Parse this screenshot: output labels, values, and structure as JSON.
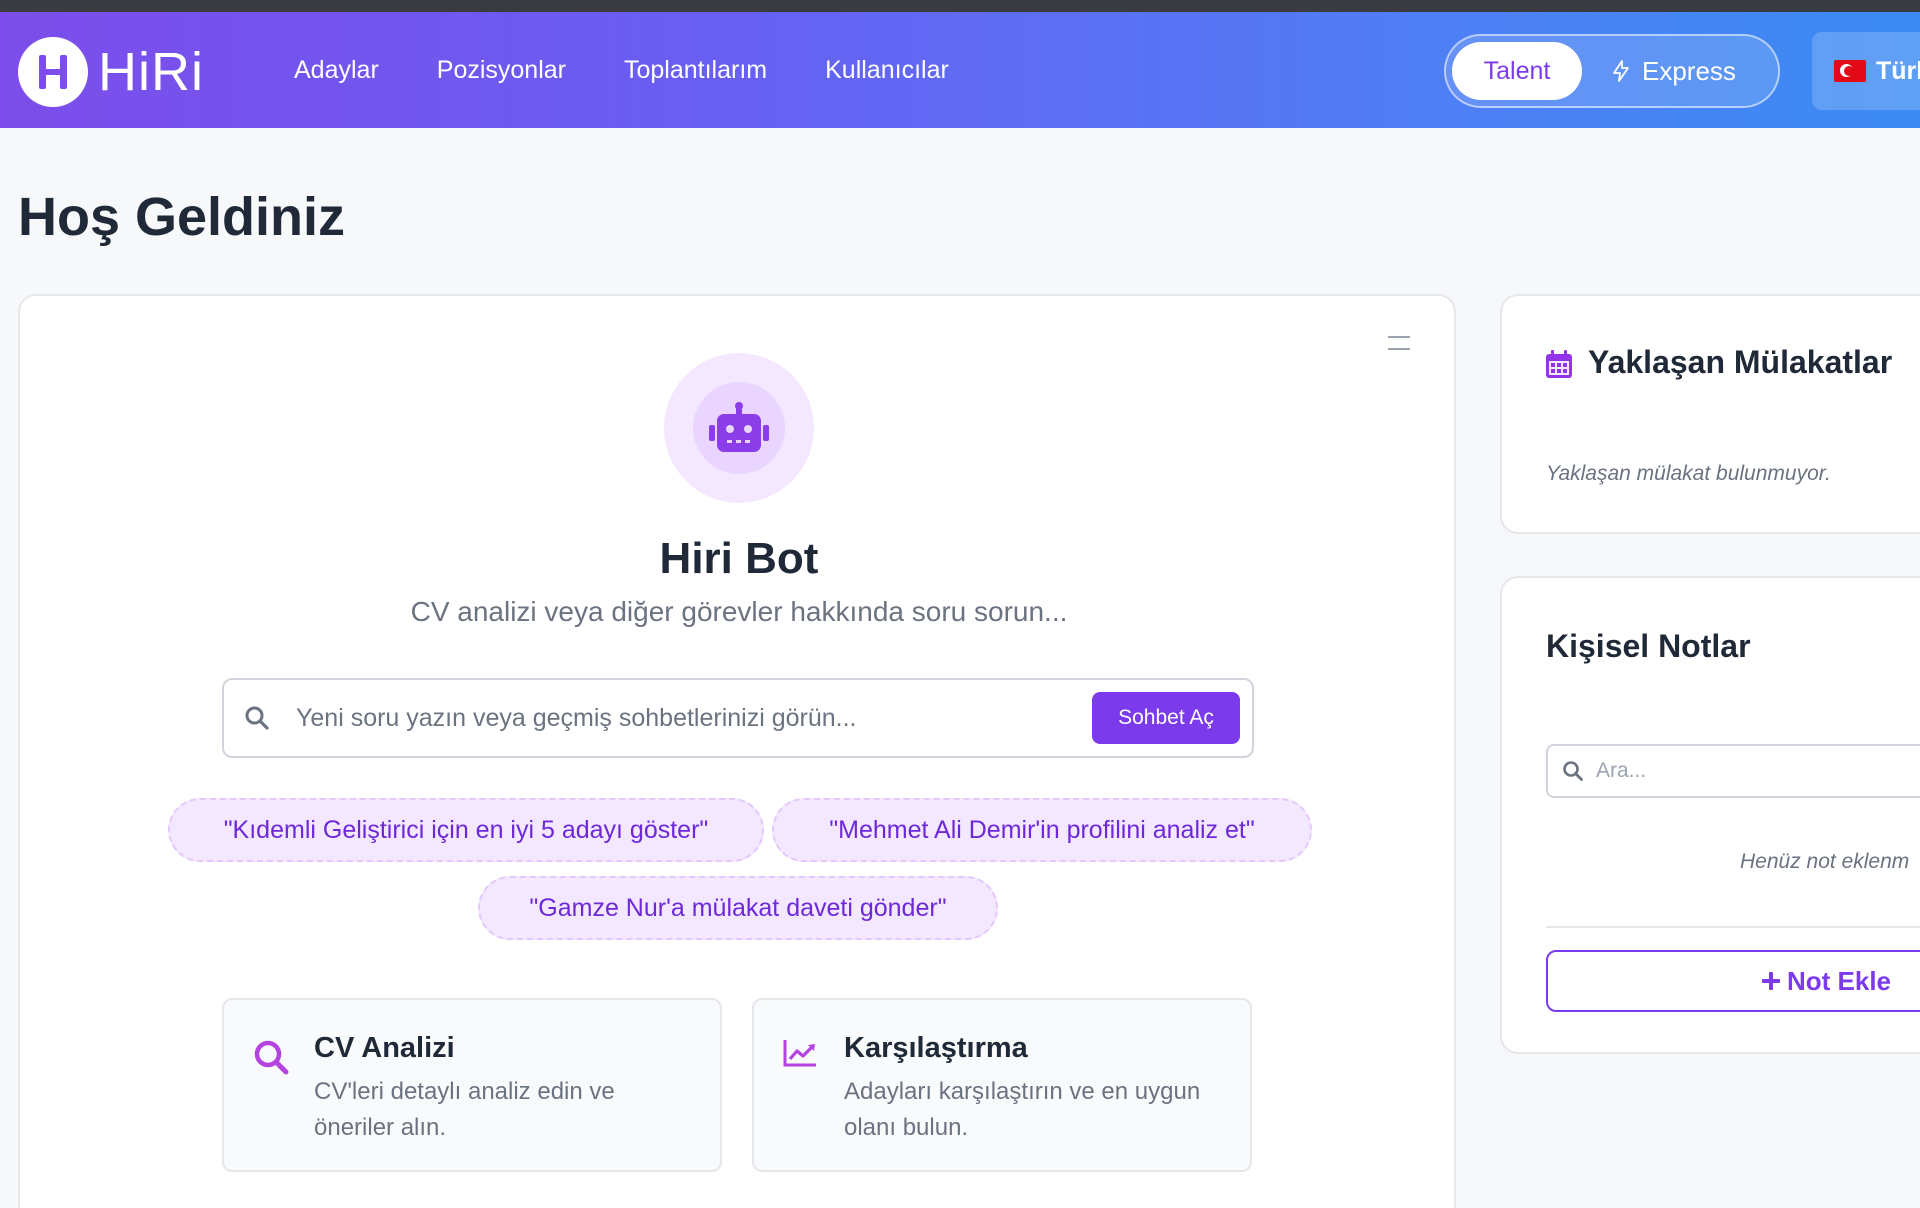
{
  "brand": {
    "name": "HiRi"
  },
  "nav": {
    "links": [
      "Adaylar",
      "Pozisyonlar",
      "Toplantılarım",
      "Kullanıcılar"
    ]
  },
  "mode_toggle": {
    "active": "Talent",
    "other": "Express"
  },
  "language": {
    "label": "Türk"
  },
  "page": {
    "title": "Hoş Geldiniz"
  },
  "bot": {
    "name": "Hiri Bot",
    "subtitle": "CV analizi veya diğer görevler hakkında soru sorun...",
    "search_placeholder": "Yeni soru yazın veya geçmiş sohbetlerinizi görün...",
    "chat_button": "Sohbet Aç",
    "suggestions": [
      "\"Kıdemli Geliştirici için en iyi 5 adayı göster\"",
      "\"Mehmet Ali Demir'in profilini analiz et\"",
      "\"Gamze Nur'a mülakat daveti gönder\""
    ],
    "features": [
      {
        "title": "CV Analizi",
        "description": "CV'leri detaylı analiz edin ve öneriler alın."
      },
      {
        "title": "Karşılaştırma",
        "description": "Adayları karşılaştırın ve en uygun olanı bulun."
      }
    ]
  },
  "interviews": {
    "title": "Yaklaşan Mülakatlar",
    "empty": "Yaklaşan mülakat bulunmuyor."
  },
  "notes": {
    "title": "Kişisel Notlar",
    "search_placeholder": "Ara...",
    "empty": "Henüz not eklenm",
    "add_button": "Not Ekle"
  },
  "colors": {
    "accent": "#7c3aed",
    "nav_gradient_start": "#7c4dea",
    "nav_gradient_end": "#3b8bf2",
    "chip_bg": "#f3e8ff"
  }
}
